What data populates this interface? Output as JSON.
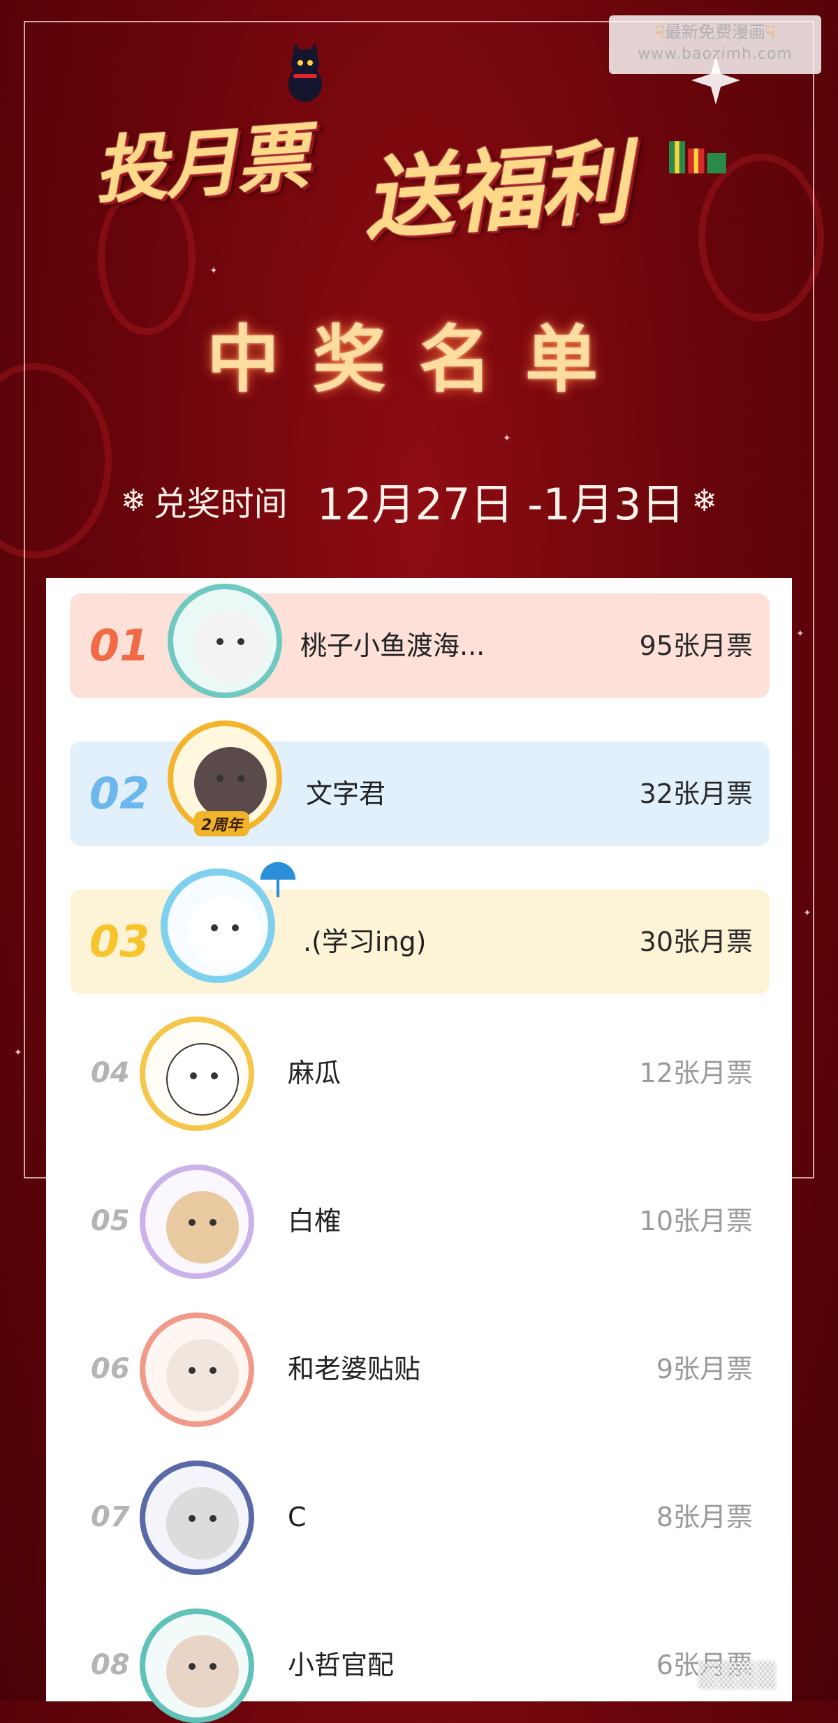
{
  "watermark": {
    "line1": "最新免费漫画",
    "line2": "www.baozimh.com"
  },
  "banner": {
    "title_left": "投月票",
    "title_right": "送福利"
  },
  "heading": "中奖名单",
  "claim": {
    "label": "兑奖时间",
    "range": "12月27日 -1月3日"
  },
  "winners": [
    {
      "rank": "01",
      "name": "桃子小鱼渡海...",
      "votes": "95张月票",
      "badge": ""
    },
    {
      "rank": "02",
      "name": "文字君",
      "votes": "32张月票",
      "badge": "2周年"
    },
    {
      "rank": "03",
      "name": ".(学习ing)",
      "votes": "30张月票",
      "badge": ""
    },
    {
      "rank": "04",
      "name": "麻瓜",
      "votes": "12张月票",
      "badge": ""
    },
    {
      "rank": "05",
      "name": "白榷",
      "votes": "10张月票",
      "badge": ""
    },
    {
      "rank": "06",
      "name": "和老婆贴贴",
      "votes": "9张月票",
      "badge": ""
    },
    {
      "rank": "07",
      "name": "C",
      "votes": "8张月票",
      "badge": ""
    },
    {
      "rank": "08",
      "name": "小哲官配",
      "votes": "6张月票",
      "badge": ""
    }
  ],
  "colors": {
    "row1_bg": "#fde1d9",
    "row2_bg": "#e2f0fc",
    "row3_bg": "#fdf3d6",
    "rank1": "#f06b45",
    "rank2": "#6cb8ee",
    "rank3": "#f7c42b",
    "banner_red": "#7a0a10"
  }
}
